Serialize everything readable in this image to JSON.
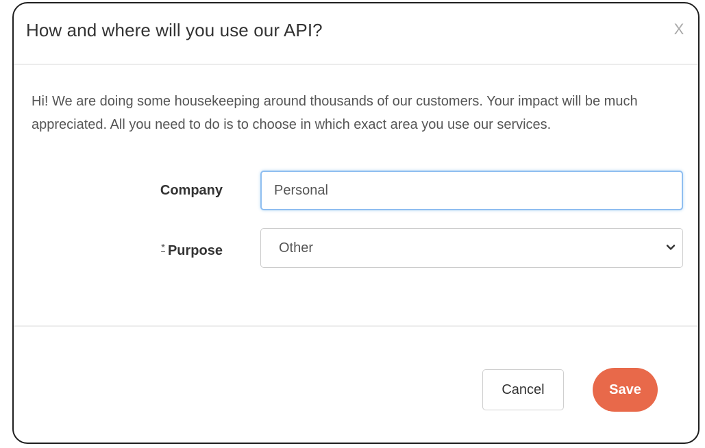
{
  "modal": {
    "title": "How and where will you use our API?",
    "close_label": "X",
    "intro_text": "Hi! We are doing some housekeeping around thousands of our customers. Your impact will be much appreciated. All you need to do is to choose in which exact area you use our services."
  },
  "form": {
    "company": {
      "label": "Company",
      "value": "Personal"
    },
    "purpose": {
      "required_marker": "*",
      "label": "Purpose",
      "selected": "Other",
      "icon": "chevron-down-icon"
    }
  },
  "footer": {
    "cancel_label": "Cancel",
    "save_label": "Save"
  },
  "colors": {
    "save_button": "#e8694a",
    "input_focus_border": "#8fbef0",
    "modal_border": "#1f1f1f"
  }
}
